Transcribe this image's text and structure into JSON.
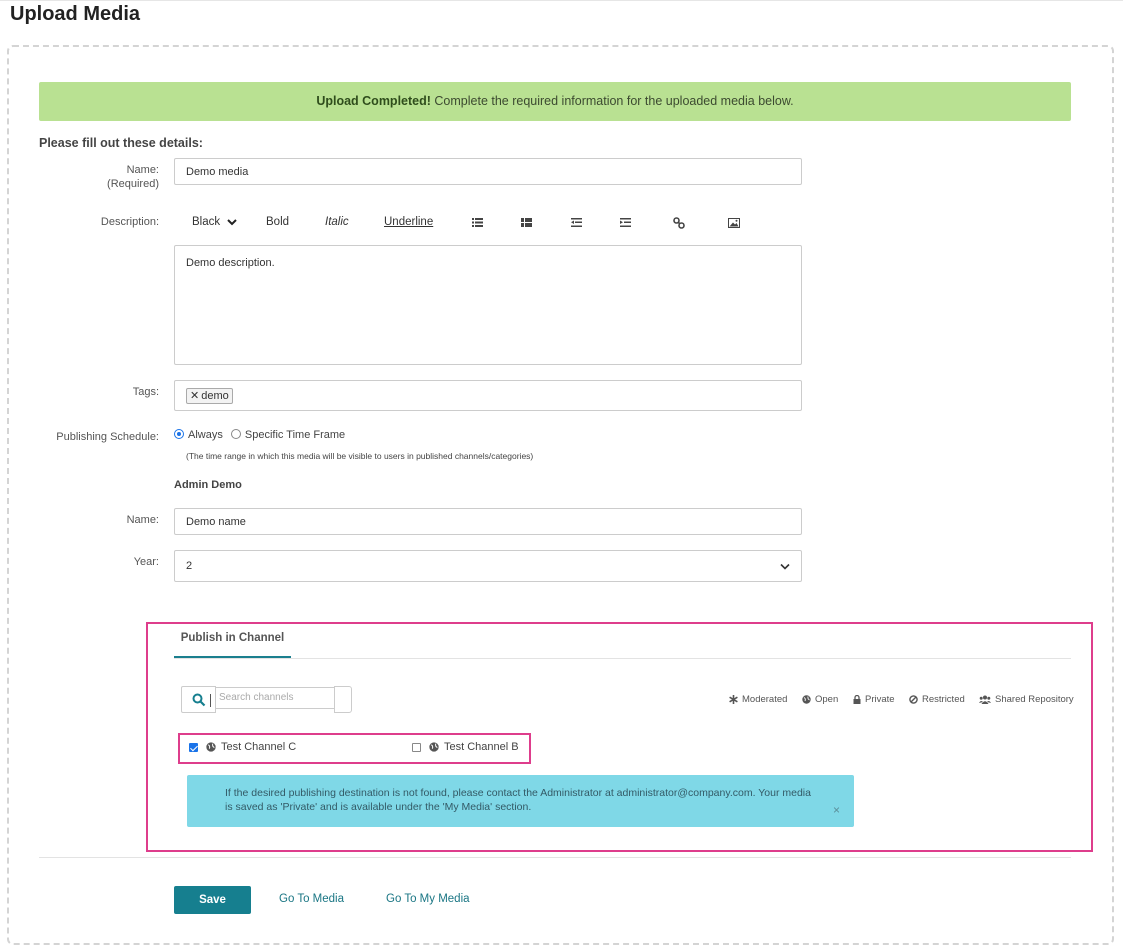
{
  "page": {
    "title": "Upload Media"
  },
  "alert": {
    "strong": "Upload Completed!",
    "text": " Complete the required information for the uploaded media below."
  },
  "form": {
    "section_title": "Please fill out these details:",
    "name_label": "Name:",
    "name_required": "(Required)",
    "name_value": "Demo media",
    "description_label": "Description:",
    "toolbar": {
      "color": "Black",
      "bold": "Bold",
      "italic": "Italic",
      "underline": "Underline"
    },
    "description_value": "Demo description.",
    "tags_label": "Tags:",
    "tags": [
      "demo"
    ],
    "schedule_label": "Publishing Schedule:",
    "schedule_options": [
      "Always",
      "Specific Time Frame"
    ],
    "schedule_selected": "Always",
    "schedule_hint": "(The time range in which this media will be visible to users in published channels/categories)",
    "custom_section": "Admin Demo",
    "custom_name_label": "Name:",
    "custom_name_value": "Demo name",
    "year_label": "Year:",
    "year_value": "2"
  },
  "publish": {
    "tab_label": "Publish in Channel",
    "search_placeholder": "Search channels",
    "legend": [
      "Moderated",
      "Open",
      "Private",
      "Restricted",
      "Shared Repository"
    ],
    "channels": [
      {
        "name": "Test Channel C",
        "checked": true
      },
      {
        "name": "Test Channel B",
        "checked": false
      }
    ],
    "info_text": "If the desired publishing destination is not found, please contact the Administrator at administrator@company.com. Your media is saved as 'Private' and is available under the 'My Media' section.",
    "info_close": "×"
  },
  "actions": {
    "save": "Save",
    "go_to_media": "Go To Media",
    "go_to_my_media": "Go To My Media"
  },
  "colors": {
    "accent": "#167f8f",
    "highlight": "#de3d8c",
    "success_bg": "#b9e192",
    "info_bg": "#7fd8e7"
  }
}
